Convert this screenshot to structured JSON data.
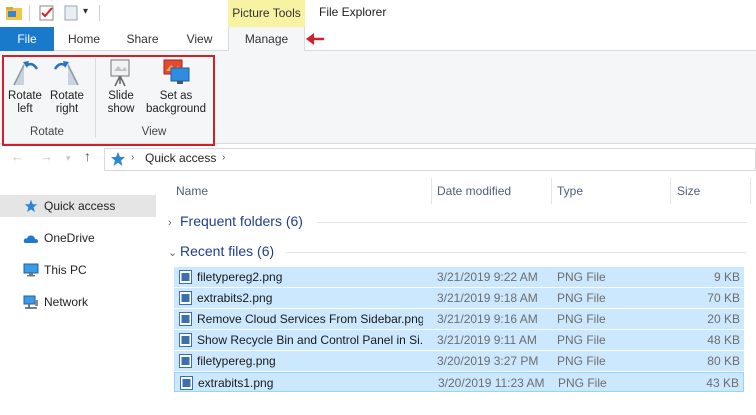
{
  "titlebar": {
    "context_tab_header": "Picture Tools",
    "window_title": "File Explorer",
    "dropdown_glyph": "▾"
  },
  "tabs": {
    "file": "File",
    "home": "Home",
    "share": "Share",
    "view": "View",
    "manage": "Manage",
    "active": "Manage"
  },
  "ribbon": {
    "rotate_left": "Rotate left",
    "rotate_right": "Rotate right",
    "slideshow": "Slide show",
    "set_background": "Set as background",
    "group_rotate": "Rotate",
    "group_view": "View"
  },
  "address": {
    "back_glyph": "←",
    "forward_glyph": "→",
    "recent_glyph": "▾",
    "up_glyph": "↑",
    "chevron": "›",
    "location": "Quick access"
  },
  "navpane": {
    "items": [
      {
        "label": "Quick access",
        "icon": "star-icon",
        "selected": true
      },
      {
        "label": "OneDrive",
        "icon": "cloud-icon"
      },
      {
        "label": "This PC",
        "icon": "monitor-icon"
      },
      {
        "label": "Network",
        "icon": "network-icon"
      }
    ]
  },
  "filelist": {
    "columns": {
      "name": "Name",
      "date": "Date modified",
      "type": "Type",
      "size": "Size"
    },
    "groups": {
      "frequent": {
        "label": "Frequent folders (6)",
        "expanded": false,
        "chevron": "›"
      },
      "recent": {
        "label": "Recent files (6)",
        "expanded": true,
        "chevron": "⌄"
      }
    },
    "rows": [
      {
        "name": "filetypereg2.png",
        "date": "3/21/2019 9:22 AM",
        "type": "PNG File",
        "size": "9 KB"
      },
      {
        "name": "extrabits2.png",
        "date": "3/21/2019 9:18 AM",
        "type": "PNG File",
        "size": "70 KB"
      },
      {
        "name": "Remove Cloud Services From Sidebar.png",
        "date": "3/21/2019 9:16 AM",
        "type": "PNG File",
        "size": "20 KB"
      },
      {
        "name": "Show Recycle Bin and Control Panel in Si...",
        "date": "3/21/2019 9:11 AM",
        "type": "PNG File",
        "size": "48 KB"
      },
      {
        "name": "filetypereg.png",
        "date": "3/20/2019 3:27 PM",
        "type": "PNG File",
        "size": "80 KB"
      },
      {
        "name": "extrabits1.png",
        "date": "3/20/2019 11:23 AM",
        "type": "PNG File",
        "size": "43 KB"
      }
    ]
  },
  "colors": {
    "file_tab": "#1979ca",
    "context_tab": "#f7f3a3",
    "selection": "#cce8ff",
    "annotation": "#d0202a"
  }
}
